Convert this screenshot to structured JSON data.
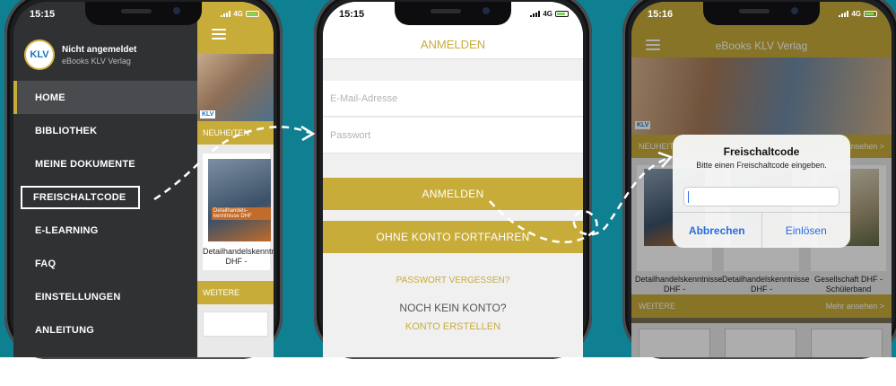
{
  "phone1": {
    "status": {
      "time": "15:15",
      "network": "4G"
    },
    "profile": {
      "logo": "KLV",
      "name": "Nicht angemeldet",
      "publisher": "eBooks KLV Verlag"
    },
    "menu": [
      {
        "label": "HOME"
      },
      {
        "label": "BIBLIOTHEK"
      },
      {
        "label": "MEINE DOKUMENTE"
      },
      {
        "label": "FREISCHALTCODE"
      },
      {
        "label": "E-LEARNING"
      },
      {
        "label": "FAQ"
      },
      {
        "label": "EINSTELLUNGEN"
      },
      {
        "label": "ANLEITUNG"
      }
    ],
    "peek": {
      "photo_logo": "KLV",
      "section_new": "NEUHEITEN",
      "book_cover_title": "Detailhandels-kenntnisse DHF",
      "book_caption": "Detailhandelskenntnisse DHF -",
      "section_more": "WEITERE"
    }
  },
  "phone2": {
    "status": {
      "time": "15:15",
      "network": "4G"
    },
    "header_title": "ANMELDEN",
    "email_placeholder": "E-Mail-Adresse",
    "password_placeholder": "Passwort",
    "login_button": "ANMELDEN",
    "continue_button": "OHNE KONTO FORTFAHREN",
    "forgot_password": "PASSWORT VERGESSEN?",
    "no_account": "NOCH KEIN KONTO?",
    "create_account": "KONTO ERSTELLEN"
  },
  "phone3": {
    "status": {
      "time": "15:16",
      "network": "4G"
    },
    "header_title": "eBooks KLV Verlag",
    "hero_logo": "KLV",
    "section_new": "NEUHEITEN",
    "section_new_more": "Mehr ansehen >",
    "books": [
      {
        "caption": "Detailhandelskenntnisse DHF -"
      },
      {
        "caption": "Detailhandelskenntnisse DHF -"
      },
      {
        "caption": "Gesellschaft DHF - Schülerband"
      }
    ],
    "section_more": "WEITERE",
    "section_more_link": "Mehr ansehen >",
    "dialog": {
      "title": "Freischaltcode",
      "message": "Bitte einen Freischaltcode eingeben.",
      "cancel": "Abbrechen",
      "confirm": "Einlösen"
    }
  },
  "colors": {
    "background": "#0f7f92",
    "accent": "#c8ac3a",
    "drawer": "#303133",
    "ios_blue": "#2a6be0"
  }
}
